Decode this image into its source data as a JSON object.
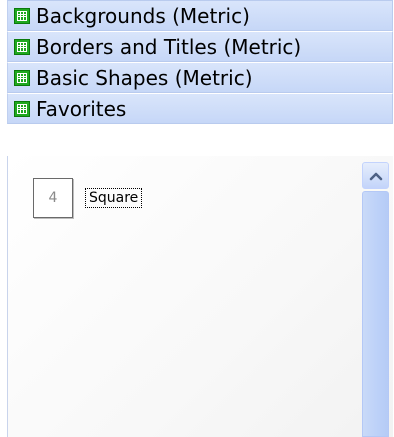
{
  "stencil_bars": [
    {
      "label": "Backgrounds (Metric)",
      "icon": "stencil-grid-icon"
    },
    {
      "label": "Borders and Titles (Metric)",
      "icon": "stencil-grid-icon"
    },
    {
      "label": "Basic Shapes (Metric)",
      "icon": "stencil-grid-icon"
    },
    {
      "label": "Favorites",
      "icon": "stencil-grid-icon"
    }
  ],
  "favorites": {
    "items": [
      {
        "label": "Square",
        "icon_glyph": "4"
      }
    ]
  },
  "scrollbar": {
    "up_icon": "chevron-up-icon"
  },
  "colors": {
    "bar_background": "#c6d7f7",
    "icon_green": "#1fa81f",
    "scroll_arrow": "#4d6185"
  }
}
